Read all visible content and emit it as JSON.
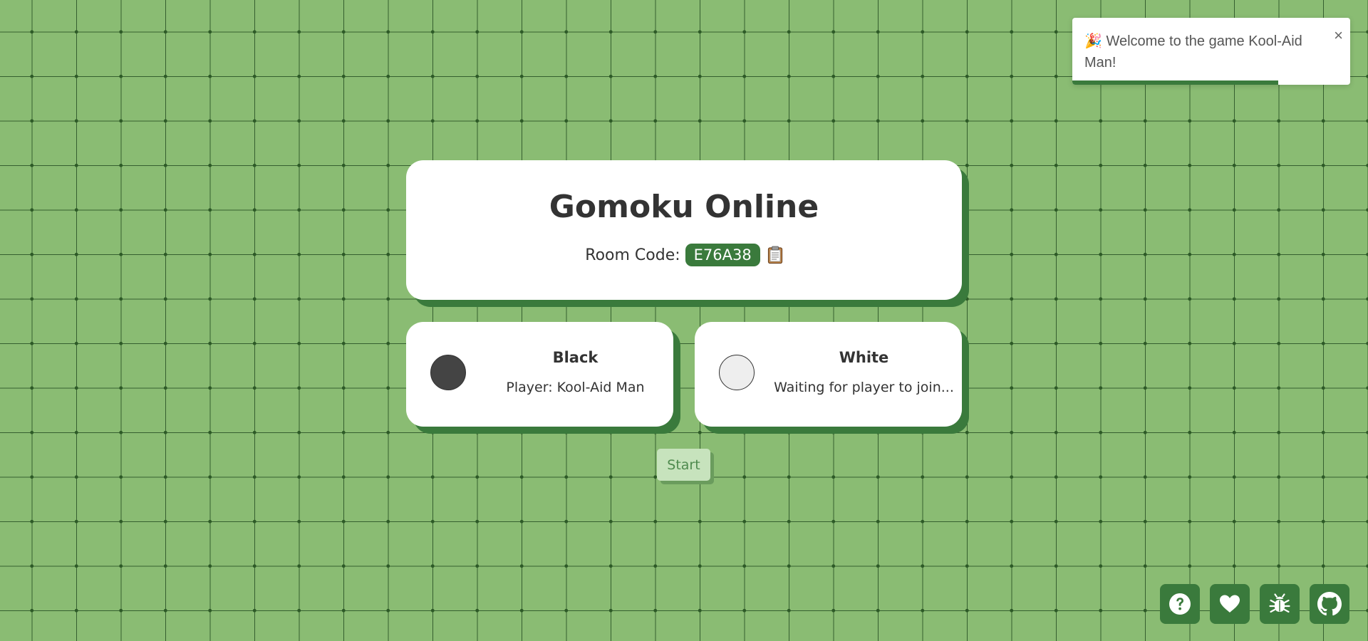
{
  "header": {
    "title": "Gomoku Online",
    "room_code_label": "Room Code:",
    "room_code": "E76A38",
    "copy_icon": "clipboard-icon"
  },
  "players": [
    {
      "color": "Black",
      "status": "Player: Kool-Aid Man"
    },
    {
      "color": "White",
      "status": "Waiting for player to join..."
    }
  ],
  "start_label": "Start",
  "toast": {
    "emoji": "🎉",
    "message": "Welcome to the game Kool-Aid Man!",
    "close_label": "×",
    "progress": 0.74
  },
  "footer_icons": [
    "help-icon",
    "heart-icon",
    "bug-icon",
    "github-icon"
  ],
  "colors": {
    "background": "#8abc73",
    "accent": "#3a7a3c",
    "card": "#ffffff"
  }
}
